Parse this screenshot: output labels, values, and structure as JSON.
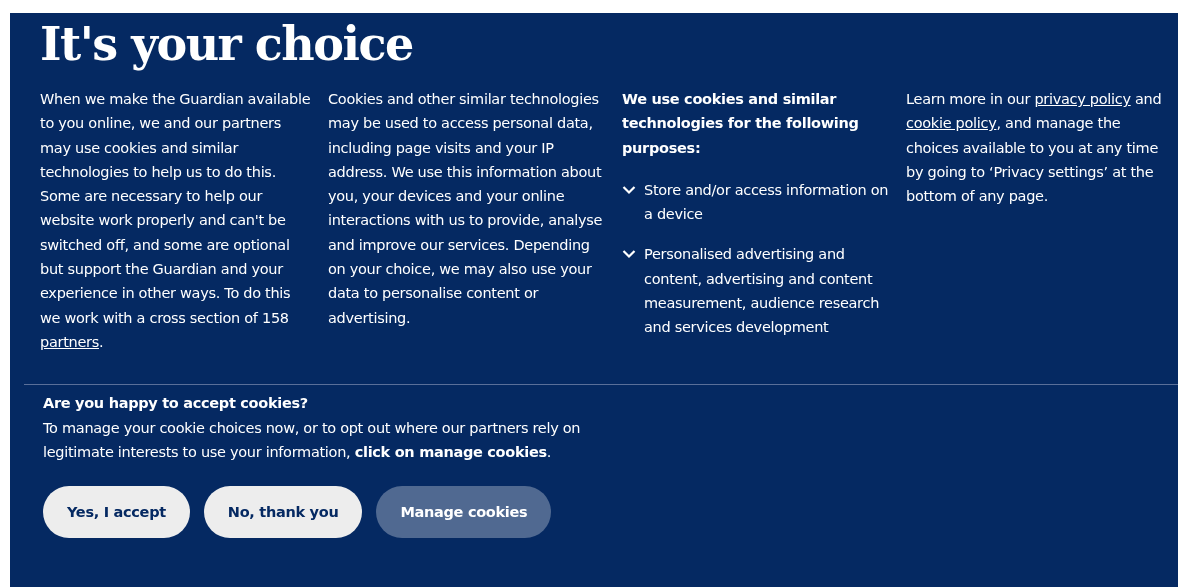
{
  "title": "It's your choice",
  "columns": [
    {
      "kind": "paragraph",
      "parts": [
        {
          "kind": "text",
          "text": "When we make the Guardian available to you online, we and our partners may use cookies and similar technologies to help us to do this. Some are necessary to help our website work properly and can't be switched off, and some are optional but support the Guardian and your experience in other ways. To do this we work with a cross section of 158 "
        },
        {
          "kind": "link",
          "text": "partners"
        },
        {
          "kind": "text",
          "text": "."
        }
      ]
    },
    {
      "kind": "paragraph",
      "parts": [
        {
          "kind": "text",
          "text": "Cookies and other similar technologies may be used to access personal data, including page visits and your IP address. We use this information about you, your devices and your online interactions with us to provide, analyse and improve our services. Depending on your choice, we may also use your data to personalise content or advertising."
        }
      ]
    },
    {
      "kind": "purposes",
      "heading": "We use cookies and similar technologies for the following purposes:",
      "items": [
        {
          "label": "Store and/or access information on a device",
          "expanded": false
        },
        {
          "label": "Personalised advertising and content, advertising and content measurement, audience research and services development",
          "expanded": false
        }
      ]
    },
    {
      "kind": "paragraph",
      "parts": [
        {
          "kind": "text",
          "text": "Learn more in our "
        },
        {
          "kind": "link",
          "text": "privacy policy"
        },
        {
          "kind": "text",
          "text": " and "
        },
        {
          "kind": "link",
          "text": "cookie policy"
        },
        {
          "kind": "text",
          "text": ", and manage the choices available to you at any time by going to ‘Privacy settings’ at the bottom of any page."
        }
      ]
    }
  ],
  "question": "Are you happy to accept cookies?",
  "explanation": "To manage your cookie choices now, or to opt out where our partners rely on legitimate interests to use your information, **click on manage cookies**.",
  "buttons": [
    {
      "label": "Yes, I accept",
      "kind": "light"
    },
    {
      "label": "No, thank you",
      "kind": "light"
    },
    {
      "label": "Manage cookies",
      "kind": "muted"
    }
  ]
}
